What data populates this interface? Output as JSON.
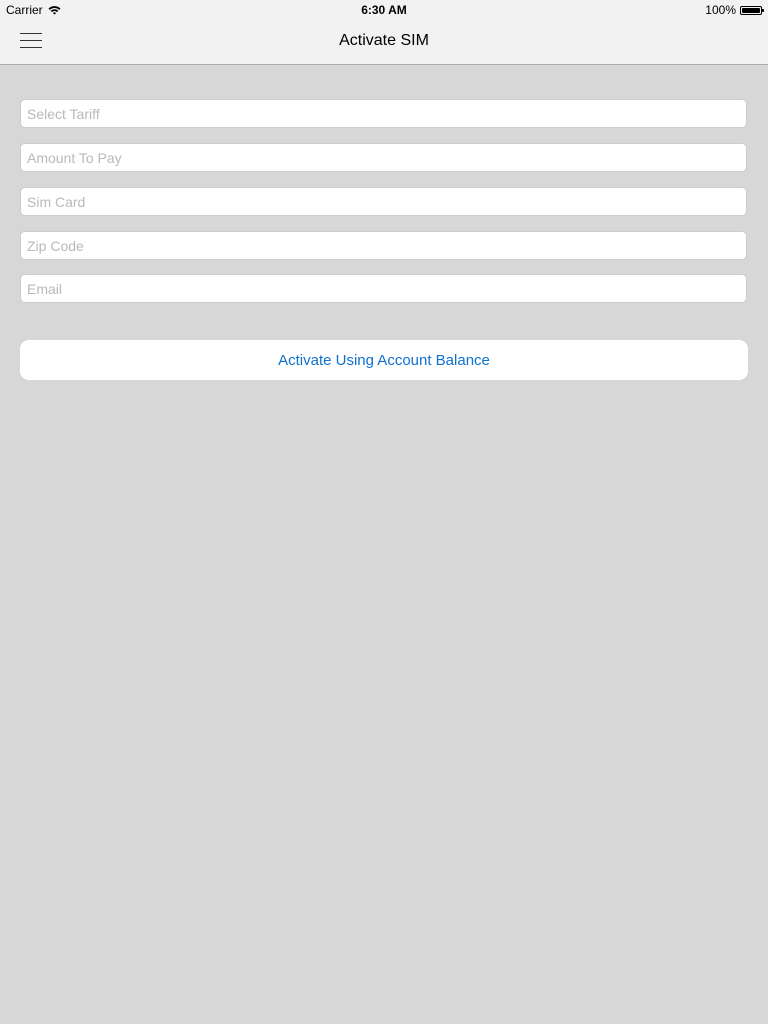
{
  "status_bar": {
    "carrier": "Carrier",
    "time": "6:30 AM",
    "battery": "100%",
    "icons": [
      "wifi-icon",
      "battery-icon"
    ]
  },
  "nav": {
    "title": "Activate SIM",
    "menu_icon": "hamburger-menu-icon"
  },
  "form": {
    "tariff_placeholder": "Select Tariff",
    "tariff_value": "",
    "amount_placeholder": "Amount To Pay",
    "amount_value": "",
    "sim_placeholder": "Sim Card",
    "sim_value": "",
    "zip_placeholder": "Zip Code",
    "zip_value": "",
    "email_placeholder": "Email",
    "email_value": ""
  },
  "actions": {
    "activate_label": "Activate Using Account Balance"
  },
  "colors": {
    "background": "#d7d7d7",
    "bar": "#f2f2f2",
    "accent": "#1071d0"
  }
}
